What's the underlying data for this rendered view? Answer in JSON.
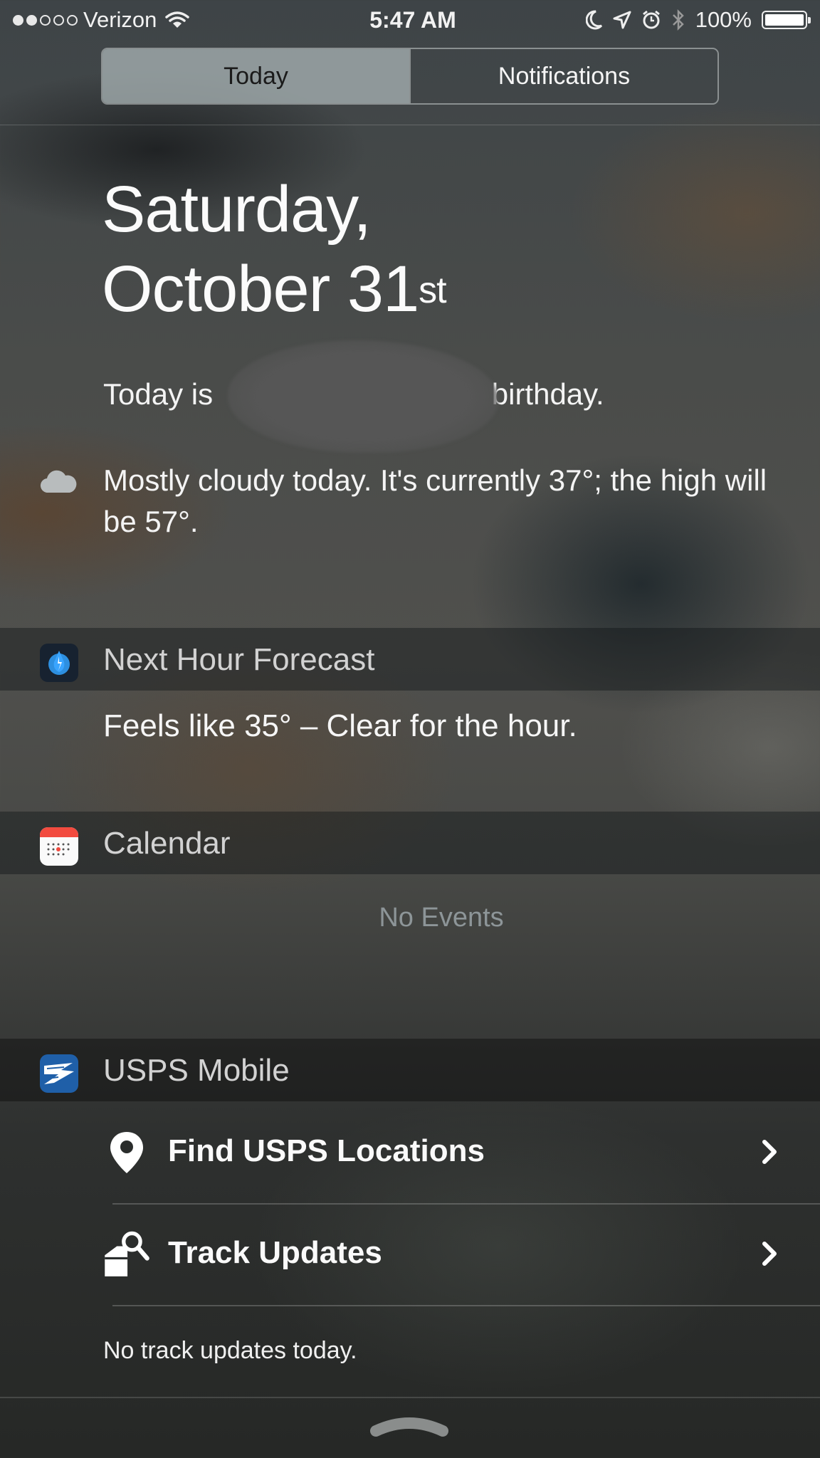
{
  "status_bar": {
    "carrier": "Verizon",
    "time": "5:47 AM",
    "battery": "100%",
    "signal_icon": "signal-dots-icon",
    "wifi_icon": "wifi-icon",
    "moon_icon": "moon-icon",
    "location_icon": "location-arrow-icon",
    "alarm_icon": "alarm-icon",
    "bluetooth_icon": "bluetooth-icon",
    "battery_icon": "battery-icon"
  },
  "tabs": {
    "today": "Today",
    "notifications": "Notifications",
    "selected": "today"
  },
  "date": {
    "line1": "Saturday,",
    "line2": "October 31",
    "suffix": "st"
  },
  "birthday": {
    "prefix": "Today is ",
    "suffix": "birthday."
  },
  "weather": {
    "summary": "Mostly cloudy today. It's currently 37°; the high will be 57°.",
    "icon": "cloud-icon"
  },
  "widgets": {
    "next_hour": {
      "title": "Next Hour Forecast",
      "text": "Feels like 35° – Clear for the hour.",
      "icon": "dark-sky-icon"
    },
    "calendar": {
      "title": "Calendar",
      "empty": "No Events",
      "icon": "calendar-icon"
    },
    "usps": {
      "title": "USPS Mobile",
      "icon": "usps-eagle-icon",
      "rows": [
        {
          "label": "Find USPS Locations",
          "icon": "map-pin-icon"
        },
        {
          "label": "Track Updates",
          "icon": "package-search-icon"
        }
      ],
      "footer": "No track updates today."
    }
  },
  "colors": {
    "calendar_red": "#f24b3f",
    "usps_blue": "#1f5fa8",
    "dark_sky_blue": "#2d8fe0"
  }
}
